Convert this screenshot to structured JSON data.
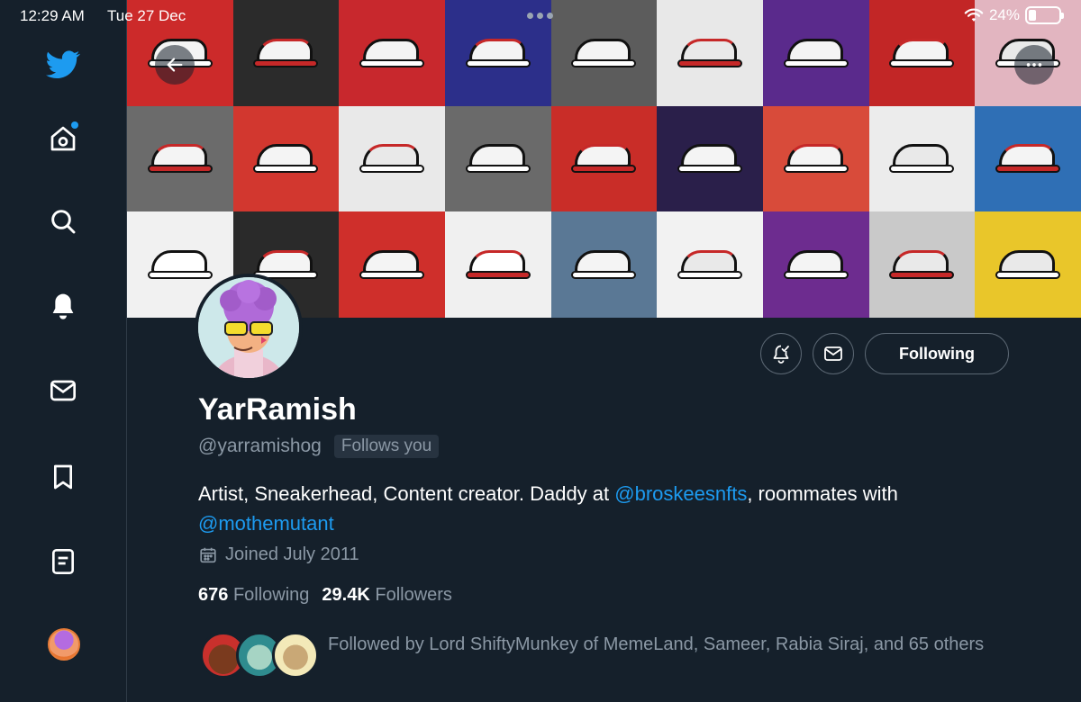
{
  "status_bar": {
    "time": "12:29 AM",
    "date": "Tue 27 Dec",
    "battery": "24%",
    "battery_level": 0.24
  },
  "sidebar": {
    "items": [
      {
        "icon": "twitter-logo-icon"
      },
      {
        "icon": "home-icon",
        "has_notification_dot": true
      },
      {
        "icon": "search-icon"
      },
      {
        "icon": "bell-icon"
      },
      {
        "icon": "mail-icon"
      },
      {
        "icon": "bookmark-icon"
      },
      {
        "icon": "list-icon"
      },
      {
        "icon": "account-avatar"
      }
    ]
  },
  "banner": {
    "description_icons": [
      "back-arrow-icon",
      "more-icon"
    ],
    "tile_colors": [
      "#cc2a2a",
      "#2b2b2b",
      "#c8282d",
      "#2c2f8a",
      "#5c5c5c",
      "#e8e8e8",
      "#5a2a8c",
      "#c22626",
      "#e2b5c0",
      "#6b6b6b",
      "#d2372f",
      "#e9e9e9",
      "#6a6a6a",
      "#c92d28",
      "#2a1f4a",
      "#d84b3a",
      "#ececec",
      "#2f6fb5",
      "#f1f1f1",
      "#2a2a2a",
      "#cf2f2b",
      "#f0f0f0",
      "#5a7895",
      "#f2f2f2",
      "#6d2c8f",
      "#c9c9c9",
      "#e9c62a"
    ]
  },
  "profile": {
    "name": "YarRamish",
    "handle": "@yarramishog",
    "follows_you": "Follows you",
    "bio_prefix": "Artist, Sneakerhead, Content creator. Daddy at ",
    "bio_mention_1": "@broskeesnfts",
    "bio_middle": ", roommates with ",
    "bio_mention_2": "@mothemutant",
    "joined": "Joined July 2011",
    "following_count": "676",
    "following_label": "Following",
    "followers_count": "29.4K",
    "followers_label": "Followers",
    "followed_by": "Followed by Lord ShiftyMunkey of MemeLand, Sameer, Rabia Siraj, and 65 others"
  },
  "actions": {
    "follow_button": "Following"
  },
  "colors": {
    "background": "#15202b",
    "accent": "#1d9bf0",
    "muted_text": "#8b98a5"
  }
}
